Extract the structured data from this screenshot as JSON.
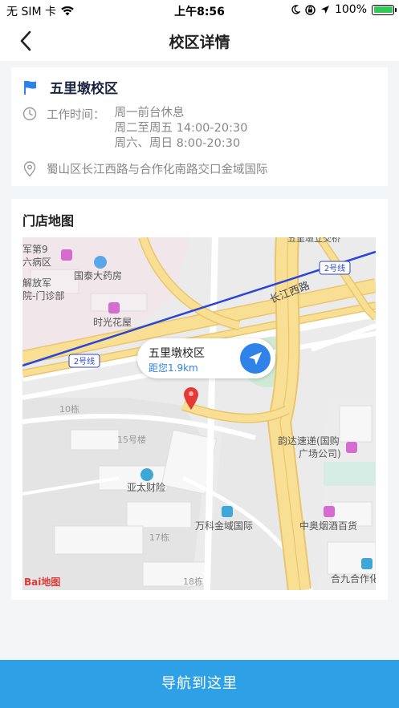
{
  "status_bar": {
    "carrier": "无 SIM 卡",
    "time": "上午8:56",
    "battery": "100%"
  },
  "nav": {
    "title": "校区详情"
  },
  "campus": {
    "name": "五里墩校区",
    "hours_label": "工作时间：",
    "hours": [
      "周一前台休息",
      "周二至周五 14:00-20:30",
      "周六、周日 8:00-20:30"
    ],
    "address": "蜀山区长江西路与合作化南路交口金域国际"
  },
  "map_section": {
    "title": "门店地图",
    "callout_name": "五里墩校区",
    "callout_distance": "距您1.9km",
    "labels": {
      "hospital": "军第9",
      "hospital2": "六病区",
      "army": "解放军",
      "clinic": "院-门诊部",
      "pharmacy": "国泰大药房",
      "shiguang": "时光花屋",
      "changjiang_road": "长江西路",
      "line2_a": "2号线",
      "line2_b": "2号线",
      "top_clip": "五里墩立交桥",
      "bldg10": "10栋",
      "bldg15": "15号楼",
      "yunda": "韵达速递(国购",
      "yunda2": "广场公司)",
      "yatai": "亚太财险",
      "vanke": "万科金域国际",
      "zhongao": "中奥烟酒百货",
      "bldg17": "17栋",
      "bldg18": "18栋",
      "hejiu": "合九合作化",
      "baidu_logo": "Bai地图"
    }
  },
  "bottom_button": {
    "label": "导航到这里"
  },
  "colors": {
    "accent": "#2ea1e6",
    "nav_blue": "#2f83e8",
    "pin_red": "#e53935",
    "road_yellow": "#f6dc8f",
    "metro_blue": "#2b46d6",
    "poi_pink": "#d66bd0"
  }
}
